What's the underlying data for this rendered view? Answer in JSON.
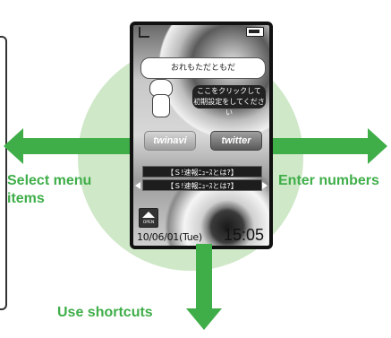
{
  "labels": {
    "select_menu": "Select menu items",
    "enter_numbers": "Enter numbers",
    "use_shortcuts": "Use shortcuts"
  },
  "phone": {
    "greeting": "おれもただともだ",
    "click_hint_line1": "ここをクリックして",
    "click_hint_line2": "初期設定をしてください",
    "buttons": {
      "twinavi": "twinavi",
      "twitter": "twitter"
    },
    "news_ticker_1": "【Ｓ!速報ﾆｭｰｽとは?】",
    "news_ticker_2": "【Ｓ!速報ﾆｭｰｽとは?】",
    "open_label": "OPEN",
    "date": "10/06/01(Tue)",
    "time": "15:05"
  },
  "colors": {
    "arrow_green": "#3fae49",
    "circle_green": "#cfe8c8"
  },
  "icons": [
    "antenna-icon",
    "battery-icon",
    "dog-mascot-icon",
    "open-triangle-icon"
  ]
}
